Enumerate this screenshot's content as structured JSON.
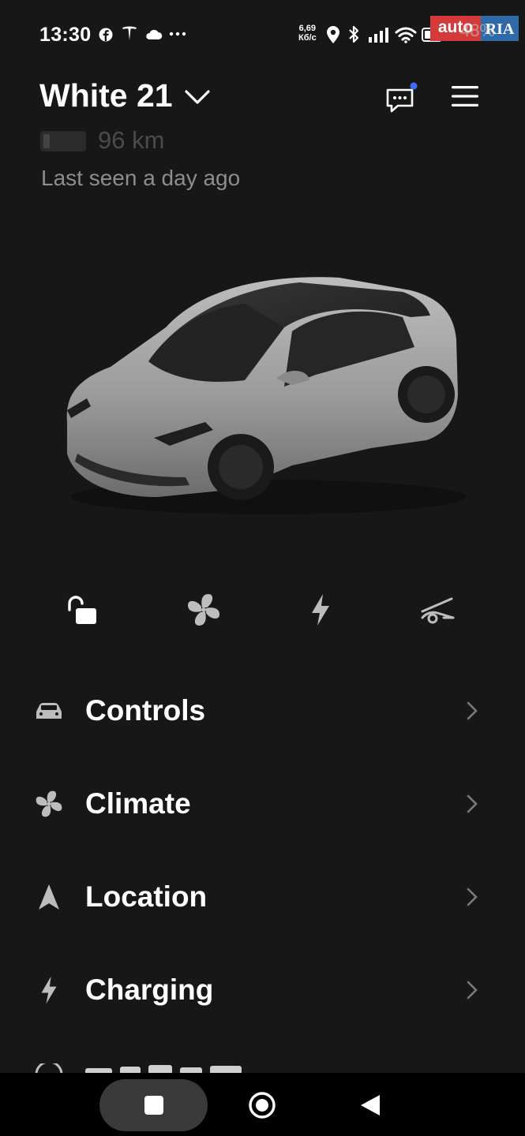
{
  "status_bar": {
    "time": "13:30",
    "notification_icons": [
      "facebook-icon",
      "tesla-icon",
      "cloud-icon",
      "more-icon"
    ],
    "net_speed_value": "6,69",
    "net_speed_unit": "Кб/с",
    "system_icons": [
      "location-icon",
      "bluetooth-icon",
      "signal-icon",
      "wifi-icon",
      "battery-icon"
    ]
  },
  "watermark": {
    "brand_left": "auto",
    "brand_right": "RIA",
    "battery_percent": "48%"
  },
  "header": {
    "car_name": "White 21",
    "range": "96 km",
    "last_seen": "Last seen a day ago",
    "battery_level": 0.15,
    "has_unread_messages": true
  },
  "quick_actions": [
    "unlock-icon",
    "fan-icon",
    "bolt-icon",
    "frunk-icon"
  ],
  "menu": [
    {
      "label": "Controls",
      "icon": "car-icon"
    },
    {
      "label": "Climate",
      "icon": "fan-icon"
    },
    {
      "label": "Location",
      "icon": "navigation-arrow-icon"
    },
    {
      "label": "Charging",
      "icon": "bolt-icon"
    }
  ],
  "nav_bar": [
    "recents-square-icon",
    "home-circle-icon",
    "back-triangle-icon"
  ],
  "colors": {
    "background": "#171717",
    "text": "#ffffff",
    "muted": "#8d8d8d",
    "accent_dot": "#3e6bff"
  }
}
